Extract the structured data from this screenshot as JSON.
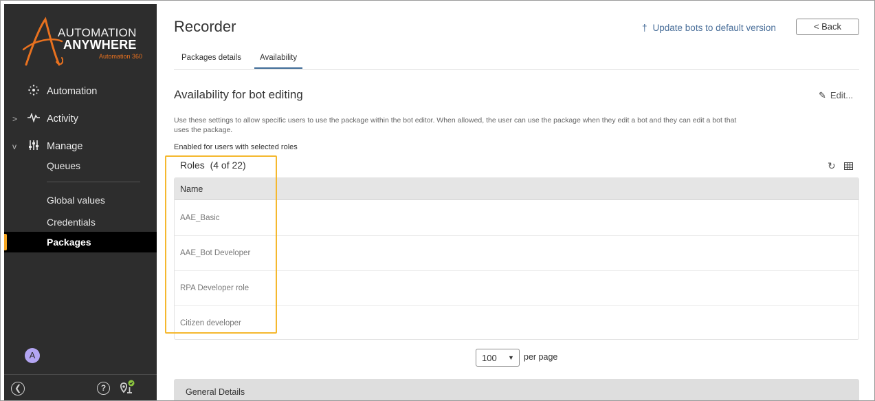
{
  "brand": {
    "line1": "AUTOMATION",
    "line2": "ANYWHERE",
    "line3": "Automation 360",
    "accent_color": "#e8711f"
  },
  "sidebar": {
    "nav": [
      {
        "label": "Automation",
        "icon": "automation-icon",
        "chevron": ""
      },
      {
        "label": "Activity",
        "icon": "activity-icon",
        "chevron": ">"
      },
      {
        "label": "Manage",
        "icon": "manage-icon",
        "chevron": "v"
      }
    ],
    "sub_items": [
      {
        "label": "Queues"
      },
      {
        "label": "Global values"
      },
      {
        "label": "Credentials"
      },
      {
        "label": "Packages",
        "active": true
      }
    ],
    "active_color": "#f5a623",
    "avatar_initial": "A",
    "bottom_icons": [
      "collapse-icon",
      "help-icon",
      "location-status-icon"
    ]
  },
  "header": {
    "title": "Recorder",
    "update_link": "Update bots to default version",
    "back_button": "< Back"
  },
  "tabs": [
    {
      "label": "Packages details",
      "active": false
    },
    {
      "label": "Availability",
      "active": true
    }
  ],
  "availability": {
    "title": "Availability for bot editing",
    "edit_label": "Edit...",
    "description": "Use these settings to allow specific users to use the package within the bot editor. When allowed, the user can use the package when they edit a bot and they can edit a bot that uses the package.",
    "enabled_label": "Enabled for users with selected roles",
    "roles_header": "Roles  (4 of 22)",
    "table": {
      "column": "Name",
      "rows": [
        "AAE_Basic",
        "AAE_Bot Developer",
        "RPA Developer role",
        "Citizen developer"
      ]
    },
    "highlight_color": "#f5b82e"
  },
  "pagination": {
    "page_size": "100",
    "per_page_label": "per page"
  },
  "general_details": {
    "title": "General Details"
  }
}
